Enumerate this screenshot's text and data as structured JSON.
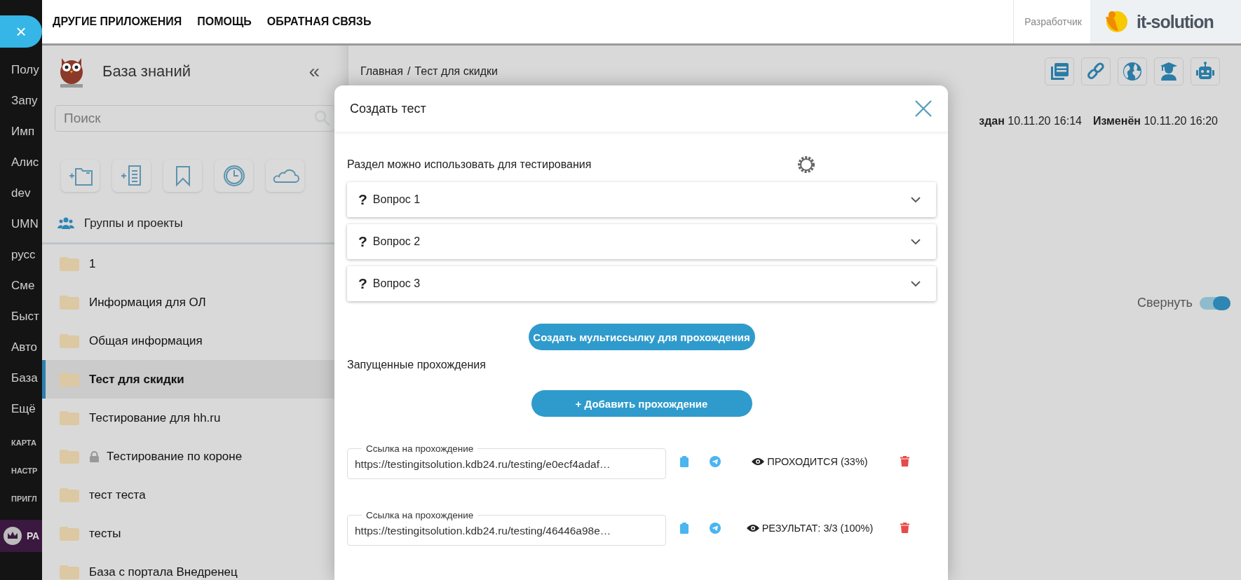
{
  "rail": {
    "close": "×",
    "items": [
      {
        "label": "Полу",
        "kind": "link"
      },
      {
        "label": "Запу",
        "kind": "link"
      },
      {
        "label": "Имп",
        "kind": "link"
      },
      {
        "label": "Алис",
        "kind": "link"
      },
      {
        "label": "dev",
        "kind": "link"
      },
      {
        "label": "UMN",
        "kind": "link"
      },
      {
        "label": "русс",
        "kind": "link"
      },
      {
        "label": "Сме",
        "kind": "link"
      },
      {
        "label": "Быст",
        "kind": "link"
      },
      {
        "label": "Авто",
        "kind": "link"
      },
      {
        "label": "База",
        "kind": "link"
      },
      {
        "label": "Ещё",
        "kind": "link"
      },
      {
        "label": "КАРТА",
        "kind": "section"
      },
      {
        "label": "НАСТР",
        "kind": "section"
      },
      {
        "label": "ПРИГЛ",
        "kind": "section"
      },
      {
        "label": "РА",
        "kind": "account"
      }
    ]
  },
  "topbar": {
    "nav": [
      "ДРУГИЕ ПРИЛОЖЕНИЯ",
      "ПОМОЩЬ",
      "ОБРАТНАЯ СВЯЗЬ"
    ],
    "role": "Разработчик",
    "logo": "it-solution"
  },
  "sidebar": {
    "title": "База знаний",
    "collapse": "«",
    "search": {
      "placeholder": "Поиск"
    },
    "groups": "Группы и проекты",
    "items": [
      {
        "label": "1",
        "selected": false,
        "locked": false
      },
      {
        "label": "Информация для ОЛ",
        "selected": false,
        "locked": false
      },
      {
        "label": "Общая информация",
        "selected": false,
        "locked": false
      },
      {
        "label": "Тест для скидки",
        "selected": true,
        "locked": false
      },
      {
        "label": "Тестирование для hh.ru",
        "selected": false,
        "locked": false
      },
      {
        "label": "Тестирование по короне",
        "selected": false,
        "locked": true
      },
      {
        "label": "тест теста",
        "selected": false,
        "locked": false
      },
      {
        "label": "тесты",
        "selected": false,
        "locked": false
      },
      {
        "label": "База с портала Внедренец",
        "selected": false,
        "locked": false
      }
    ]
  },
  "main": {
    "breadcrumb": {
      "items": [
        "Главная",
        "Тест для скидки"
      ],
      "separator": "/"
    },
    "meta": [
      {
        "label": "здан",
        "value": "10.11.20 16:14"
      },
      {
        "label": "Изменён",
        "value": "10.11.20 16:20"
      }
    ],
    "toggle": {
      "label": "Свернуть",
      "on": true
    }
  },
  "modal": {
    "title": "Создать тест",
    "note": "Раздел можно использовать для тестирования",
    "questions": [
      {
        "icon": "?",
        "label": "Вопрос 1",
        "expanded": false
      },
      {
        "icon": "?",
        "label": "Вопрос 2",
        "expanded": false
      },
      {
        "icon": "?",
        "label": "Вопрос 3",
        "expanded": false
      }
    ],
    "multilink_button": "Создать мультиссылку для прохождения",
    "runs_title": "Запущенные прохождения",
    "add_button": "+ Добавить прохождение",
    "runs": [
      {
        "field_label": "Ссылка на прохождение",
        "url": "https://testingitsolution.kdb24.ru/testing/e0ecf4adaf…",
        "status": "ПРОХОДИТСЯ (33%)"
      },
      {
        "field_label": "Ссылка на прохождение",
        "url": "https://testingitsolution.kdb24.ru/testing/46446a98e…",
        "status": "РЕЗУЛЬТАТ: 3/3 (100%)"
      }
    ]
  }
}
